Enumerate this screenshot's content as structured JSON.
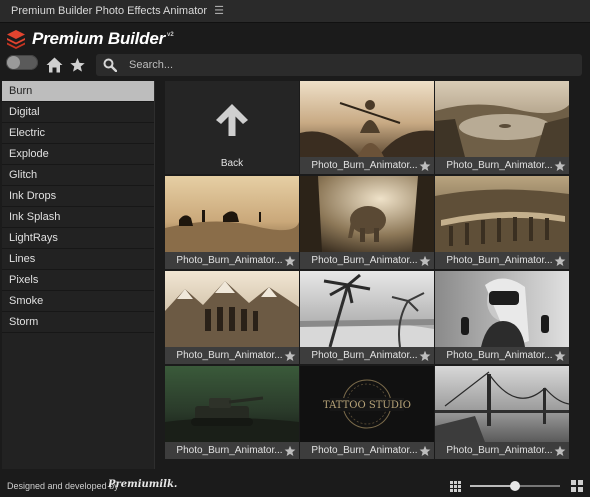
{
  "window": {
    "title": "Premium Builder Photo Effects Animator",
    "menu_icon": "hamburger-icon"
  },
  "brand": {
    "name": "Premium Builder",
    "version": "v2"
  },
  "toolbar": {
    "search_placeholder": "Search..."
  },
  "sidebar": {
    "active": "Burn",
    "items": [
      "Burn",
      "Digital",
      "Electric",
      "Explode",
      "Glitch",
      "Ink Drops",
      "Ink Splash",
      "LightRays",
      "Lines",
      "Pixels",
      "Smoke",
      "Storm"
    ]
  },
  "grid": {
    "back_label": "Back",
    "items": [
      {
        "label": "Photo_Burn_Animator...",
        "scene": "kayak"
      },
      {
        "label": "Photo_Burn_Animator...",
        "scene": "lake"
      },
      {
        "label": "Photo_Burn_Animator...",
        "scene": "desert"
      },
      {
        "label": "Photo_Burn_Animator...",
        "scene": "elephant"
      },
      {
        "label": "Photo_Burn_Animator...",
        "scene": "viaduct"
      },
      {
        "label": "Photo_Burn_Animator...",
        "scene": "hikers"
      },
      {
        "label": "Photo_Burn_Animator...",
        "scene": "palms"
      },
      {
        "label": "Photo_Burn_Animator...",
        "scene": "vr"
      },
      {
        "label": "Photo_Burn_Animator...",
        "scene": "tank"
      },
      {
        "label": "Photo_Burn_Animator...",
        "scene": "tattoo",
        "text": "TATTOO STUDIO"
      },
      {
        "label": "Photo_Burn_Animator...",
        "scene": "bridge"
      }
    ]
  },
  "footer": {
    "credit": "Designed and developed by",
    "maker": "Premiumilk.",
    "thumb_size": 0.5
  },
  "colors": {
    "active_category": "#bdbdbd",
    "background": "#1b1b1b",
    "caption_bar": "#3d3d3d",
    "logo_red": "#e2442f"
  }
}
